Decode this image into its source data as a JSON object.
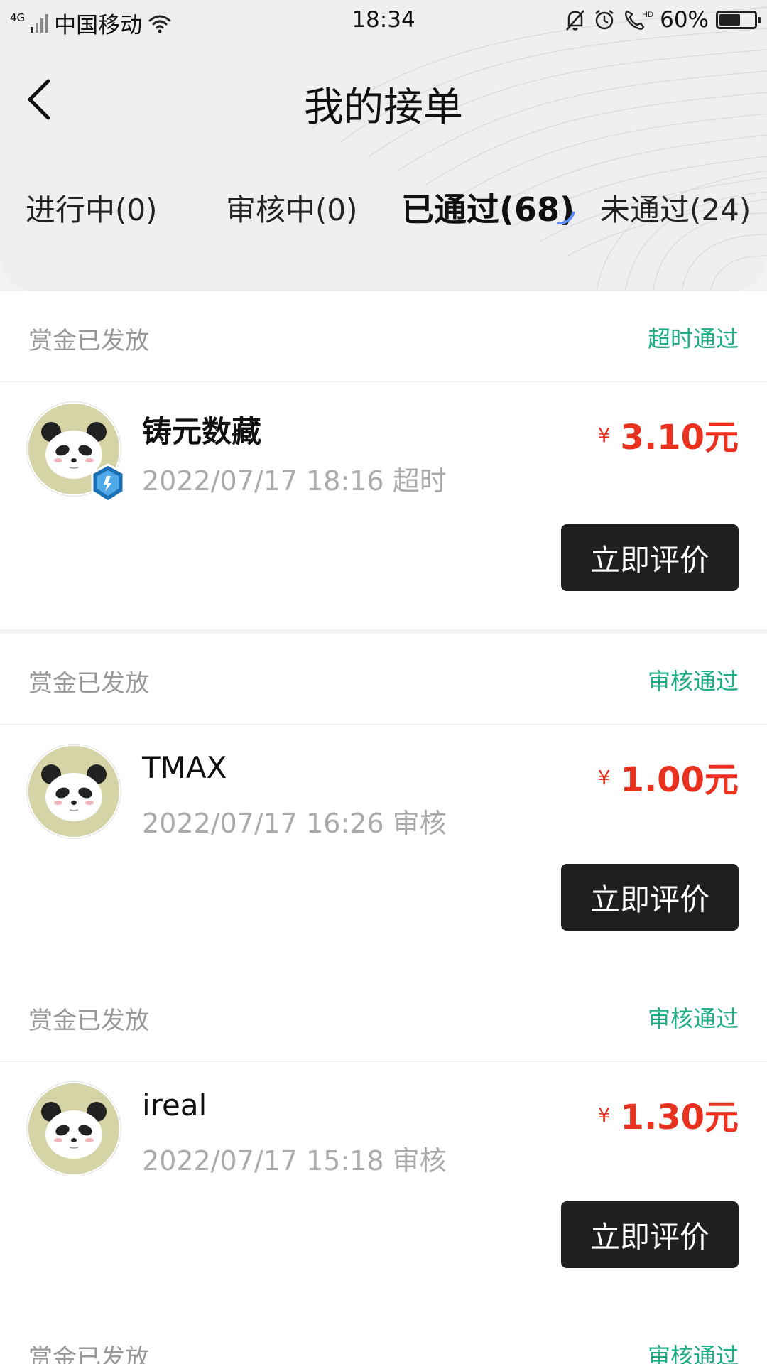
{
  "status_bar": {
    "network": "4G",
    "carrier": "中国移动",
    "time": "18:34",
    "battery": "60%",
    "battery_level": 0.6,
    "icons": [
      "signal-icon",
      "wifi-icon",
      "mute-bell-icon",
      "alarm-icon",
      "hd-call-icon",
      "battery-icon"
    ]
  },
  "header": {
    "title": "我的接单",
    "back_icon": "chevron-left-icon"
  },
  "tabs": [
    {
      "label": "进行中(0)",
      "active": false
    },
    {
      "label": "审核中(0)",
      "active": false
    },
    {
      "label": "已通过(68)",
      "active": true
    },
    {
      "label": "未通过(24)",
      "active": false
    }
  ],
  "orders": [
    {
      "status": "赏金已发放",
      "result": "超时通过",
      "name": "铸元数藏",
      "date": "2022/07/17 18:16 超时",
      "currency": "¥",
      "amount": "3.10",
      "unit": "元",
      "button": "立即评价",
      "verified_badge": true
    },
    {
      "status": "赏金已发放",
      "result": "审核通过",
      "name": "TMAX",
      "date": "2022/07/17 16:26 审核",
      "currency": "¥",
      "amount": "1.00",
      "unit": "元",
      "button": "立即评价",
      "verified_badge": false
    },
    {
      "status": "赏金已发放",
      "result": "审核通过",
      "name": "ireal",
      "date": "2022/07/17 15:18 审核",
      "currency": "¥",
      "amount": "1.30",
      "unit": "元",
      "button": "立即评价",
      "verified_badge": false
    },
    {
      "status": "赏金已发放",
      "result": "审核通过"
    }
  ],
  "colors": {
    "accent_red": "#e8321f",
    "accent_green": "#1fae84",
    "button_dark": "#1f1f1f",
    "tab_indicator": "#5b8cf5"
  }
}
